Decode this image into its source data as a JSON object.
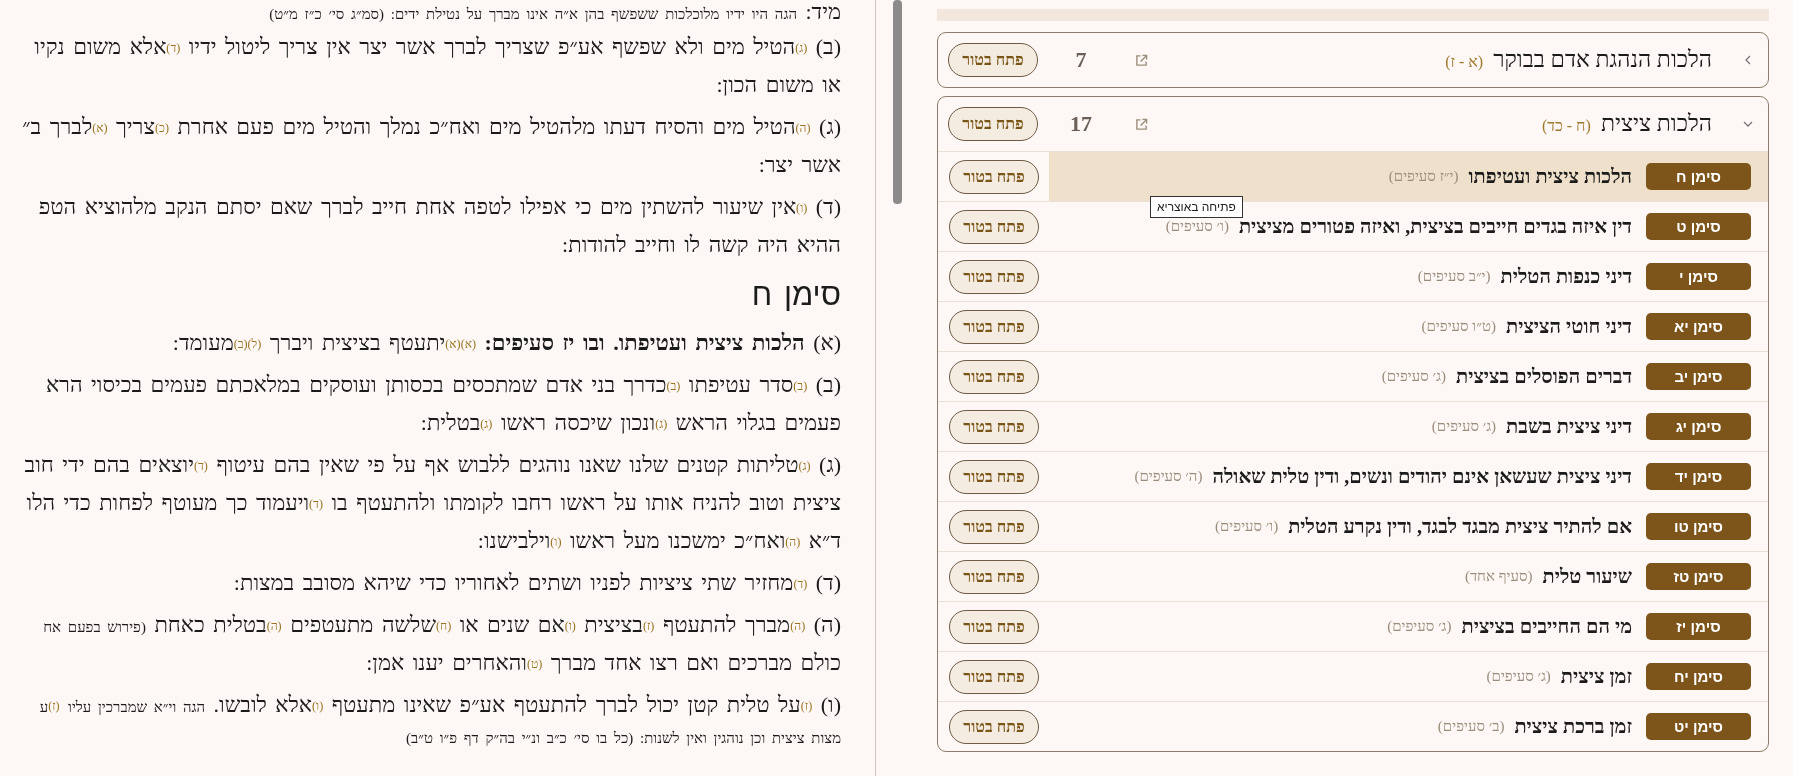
{
  "reader": {
    "lines": [
      {
        "kind": "gloss",
        "text": "מיד: $_{הגה היו ידיו מלוכלכות ששפשף בהן א״ה אינו מברך על נטילת ידים: (סמ״ג סי׳ כ״ז מ״ט)}$"
      },
      {
        "kind": "para",
        "text": "(ב) $^{(ג)}$הטיל מים ולא שפשף אע״פ שצריך לברך אשר יצר אין צריך ליטול ידיו $^{(ד)}$אלא משום נקיו"
      },
      {
        "kind": "cont",
        "text": "או משום הכון:"
      },
      {
        "kind": "para",
        "text": "(ג) $^{(ה)}$הטיל מים והסיח דעתו מלהטיל מים ואח״כ נמלך והטיל מים פעם אחרת $^{(כ)}$צריך $^{(א)}$לברך ב״"
      },
      {
        "kind": "cont",
        "text": "אשר יצר:"
      },
      {
        "kind": "para",
        "text": "(ד) $^{(ו)}$אין שיעור להשתין מים כי אפילו לטפה אחת חייב לברך שאם יסתם הנקב מלהוציא הטפ"
      },
      {
        "kind": "cont",
        "text": "ההיא היה קשה לו וחייב להודות:"
      },
      {
        "kind": "heading",
        "text": "סימן ח"
      },
      {
        "kind": "para",
        "text": "(א) **הלכות ציצית ועטיפתו. ובו יז סעיפים:** $^{(א)(א)}$יתעטף בציצית ויברך $^{(ל)(ב)}$מעומד:"
      },
      {
        "kind": "para",
        "text": "(ב) $^{(ב)}$סדר עטיפתו $^{(ב)}$כדרך בני אדם שמתכסים בכסותן ועוסקים במלאכתם פעמים בכיסוי הרא"
      },
      {
        "kind": "cont",
        "text": "פעמים בגלוי הראש $^{(ג)}$ונכון שיכסה ראשו $^{(ג)}$בטלית:"
      },
      {
        "kind": "para",
        "text": "(ג) $^{(ג)}$טליתות קטנים שלנו שאנו נוהגים ללבוש אף על פי שאין בהם עיטוף $^{(ד)}$יוצאים בהם ידי חוב"
      },
      {
        "kind": "cont",
        "text": "ציצית וטוב להניח אותו על ראשו רחבו לקומתו ולהתעטף בו $^{(ד)}$ויעמוד כך מעוטף לפחות כדי הלו"
      },
      {
        "kind": "cont",
        "text": "ד״א $^{(ה)}$ואח״כ ימשכנו מעל ראשו $^{(ו)}$וילבישנו:"
      },
      {
        "kind": "para",
        "text": "(ד) $^{(ד)}$מחזיר שתי ציציות לפניו ושתים לאחוריו כדי שיהא מסובב במצות:"
      },
      {
        "kind": "para",
        "text": "(ה) $^{(ה)}$מברך להתעטף $^{(ז)}$בציצית $^{(ו)}$אם שנים או $^{(ח)}$שלשה מתעטפים $^{(ה)}$בטלית כאחת $_{(פירוש בפעם אח}$"
      },
      {
        "kind": "cont",
        "text": "כולם מברכים ואם רצו אחד מברך $^{(ט)}$והאחרים יענו אמן:"
      },
      {
        "kind": "para",
        "text": "(ו) $^{(ז)}$על טלית קטן יכול לברך להתעטף אע״פ שאינו מתעטף $^{(ו)}$אלא לובשו. $_{הגה וי״א שמברכין עליו}$ $^{(ז)}$$_{ע}$"
      },
      {
        "kind": "gloss",
        "text": "$_{מצות ציצית וכן נוהגין ואין לשנות: (כל בו סי׳ כ״ב ונ״י בה״ק דף פ״ו ט״ב)}$"
      }
    ]
  },
  "sections": [
    {
      "title": "הלכות הנהגת אדם בבוקר",
      "range": "(א - ז)",
      "count": "7",
      "button": "פתח בטור",
      "expanded": false
    },
    {
      "title": "הלכות ציצית",
      "range": "(ח - כד)",
      "count": "17",
      "button": "פתח בטור",
      "expanded": true,
      "simanim": [
        {
          "badge": "סימן ח",
          "title": "הלכות ציצית ועטיפתו",
          "count": "(י״ז סעיפים)",
          "button": "פתח בטור",
          "selected": true
        },
        {
          "badge": "סימן ט",
          "title": "דין איזה בגדים חייבים בציצית, ואיזה פטורים מציצית",
          "count": "(ו׳ סעיפים)",
          "button": "פתח בטור",
          "selected": false,
          "tooltip": "פתיחה באוצריא"
        },
        {
          "badge": "סימן י",
          "title": "דיני כנפות הטלית",
          "count": "(י״ב סעיפים)",
          "button": "פתח בטור",
          "selected": false
        },
        {
          "badge": "סימן יא",
          "title": "דיני חוטי הציצית",
          "count": "(ט״ו סעיפים)",
          "button": "פתח בטור",
          "selected": false
        },
        {
          "badge": "סימן יב",
          "title": "דברים הפוסלים בציצית",
          "count": "(ג׳ סעיפים)",
          "button": "פתח בטור",
          "selected": false
        },
        {
          "badge": "סימן יג",
          "title": "דיני ציצית בשבת",
          "count": "(ג׳ סעיפים)",
          "button": "פתח בטור",
          "selected": false
        },
        {
          "badge": "סימן יד",
          "title": "דיני ציצית שעשאן אינם יהודים ונשים, ודין טלית שאולה",
          "count": "(ה׳ סעיפים)",
          "button": "פתח בטור",
          "selected": false
        },
        {
          "badge": "סימן טו",
          "title": "אם להתיר ציצית מבגד לבגד, ודין נקרע הטלית",
          "count": "(ו׳ סעיפים)",
          "button": "פתח בטור",
          "selected": false
        },
        {
          "badge": "סימן טז",
          "title": "שיעור טלית",
          "count": "(סעיף אחד)",
          "button": "פתח בטור",
          "selected": false
        },
        {
          "badge": "סימן יז",
          "title": "מי הם החייבים בציצית",
          "count": "(ג׳ סעיפים)",
          "button": "פתח בטור",
          "selected": false
        },
        {
          "badge": "סימן יח",
          "title": "זמן ציצית",
          "count": "(ג׳ סעיפים)",
          "button": "פתח בטור",
          "selected": false
        },
        {
          "badge": "סימן יט",
          "title": "זמן ברכת ציצית",
          "count": "(ב׳ סעיפים)",
          "button": "פתח בטור",
          "selected": false
        }
      ]
    }
  ]
}
